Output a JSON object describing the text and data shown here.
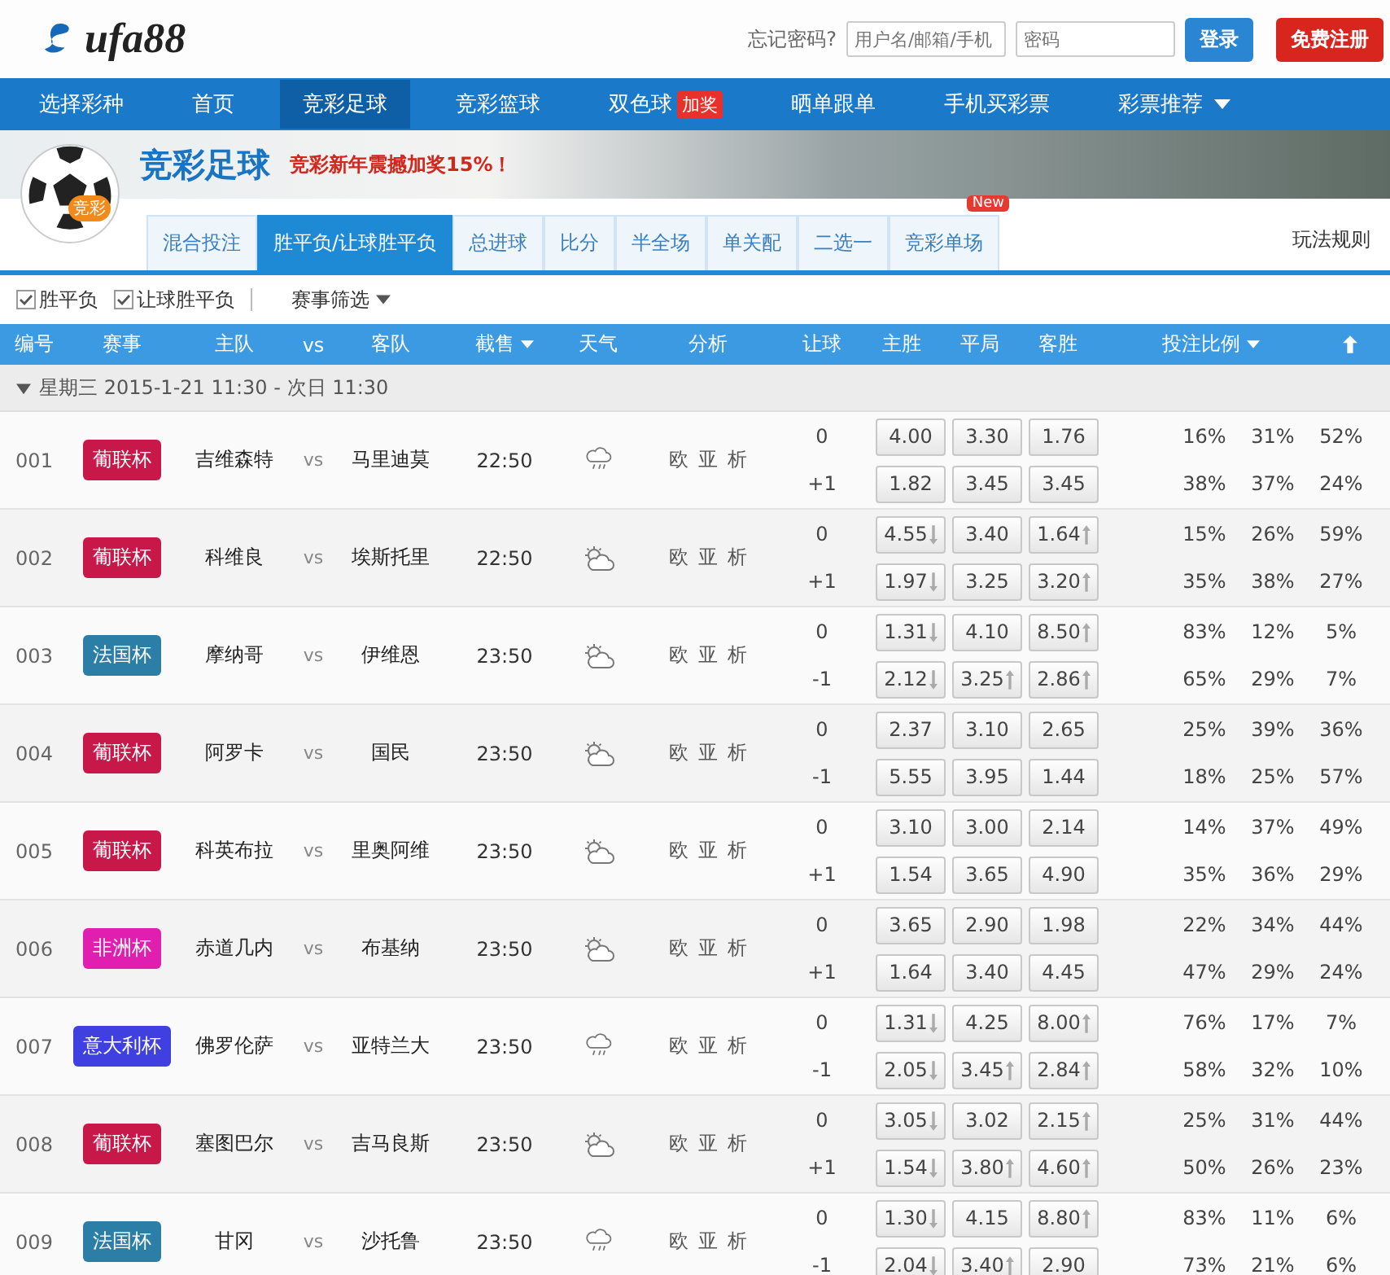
{
  "header": {
    "logo": "ufa88",
    "forgot_password": "忘记密码?",
    "username": {
      "placeholder": "用户名/邮箱/手机"
    },
    "password": {
      "placeholder": "密码"
    },
    "buttons": [
      {
        "label": "登录",
        "kind": "login"
      },
      {
        "label": "免费注册",
        "kind": "register"
      }
    ]
  },
  "nav": {
    "items": [
      {
        "label": "选择彩种",
        "selected": false
      },
      {
        "label": "首页",
        "selected": false
      },
      {
        "label": "竞彩足球",
        "selected": true
      },
      {
        "label": "竞彩篮球",
        "selected": false
      },
      {
        "label": "双色球",
        "selected": false,
        "badge": "加奖"
      },
      {
        "label": "晒单跟单",
        "selected": false
      },
      {
        "label": "手机买彩票",
        "selected": false
      },
      {
        "label": "彩票推荐",
        "selected": false,
        "dropdown": true
      }
    ]
  },
  "banner": {
    "logo_badge": "竞彩",
    "title": "竞彩足球",
    "promo": "竞彩新年震撼加奖15%！"
  },
  "tabs": [
    {
      "label": "混合投注",
      "selected": false
    },
    {
      "label": "胜平负/让球胜平负",
      "selected": true
    },
    {
      "label": "总进球",
      "selected": false
    },
    {
      "label": "比分",
      "selected": false
    },
    {
      "label": "半全场",
      "selected": false
    },
    {
      "label": "单关配",
      "selected": false
    },
    {
      "label": "二选一",
      "selected": false
    },
    {
      "label": "竞彩单场",
      "selected": false,
      "badge": "New"
    }
  ],
  "rules_link": "玩法规则",
  "filters": {
    "checkboxes": [
      {
        "label": "胜平负",
        "checked": true
      },
      {
        "label": "让球胜平负",
        "checked": true
      }
    ],
    "dropdown": "赛事筛选"
  },
  "table": {
    "columns": [
      {
        "label": "编号",
        "sortable": false
      },
      {
        "label": "赛事",
        "sortable": false
      },
      {
        "label": "主队",
        "sortable": false
      },
      {
        "label": "vs",
        "sortable": false
      },
      {
        "label": "客队",
        "sortable": false
      },
      {
        "label": "截售",
        "sortable": true
      },
      {
        "label": "天气",
        "sortable": false
      },
      {
        "label": "分析",
        "sortable": false
      },
      {
        "label": "让球",
        "sortable": false
      },
      {
        "label": "主胜",
        "sortable": false
      },
      {
        "label": "平局",
        "sortable": false
      },
      {
        "label": "客胜",
        "sortable": false
      },
      {
        "label": "投注比例",
        "sortable": true
      }
    ],
    "group": {
      "label": "星期三 2015-1-21 11:30 - 次日 11:30",
      "expanded": true
    },
    "rows": [
      {
        "id": "001",
        "league": "葡联杯",
        "color": "#c8184a",
        "home": "吉维森特",
        "vs": "vs",
        "away": "马里迪莫",
        "time": "22:50",
        "weather": {
          "kind": "rain"
        },
        "analysis": [
          "欧",
          "亚",
          "析"
        ],
        "lines": [
          {
            "handicap": "0",
            "odds": [
              {
                "v": "4.00",
                "kind": "flat"
              },
              {
                "v": "3.30",
                "kind": "flat"
              },
              {
                "v": "1.76",
                "kind": "flat"
              }
            ],
            "ratios": [
              "16%",
              "31%",
              "52%"
            ]
          },
          {
            "handicap": "+1",
            "odds": [
              {
                "v": "1.82",
                "kind": "flat"
              },
              {
                "v": "3.45",
                "kind": "flat"
              },
              {
                "v": "3.45",
                "kind": "flat"
              }
            ],
            "ratios": [
              "38%",
              "37%",
              "24%"
            ]
          }
        ]
      },
      {
        "id": "002",
        "league": "葡联杯",
        "color": "#c8184a",
        "home": "科维良",
        "vs": "vs",
        "away": "埃斯托里",
        "time": "22:50",
        "weather": {
          "kind": "cloudy"
        },
        "analysis": [
          "欧",
          "亚",
          "析"
        ],
        "lines": [
          {
            "handicap": "0",
            "odds": [
              {
                "v": "4.55",
                "kind": "down"
              },
              {
                "v": "3.40",
                "kind": "flat"
              },
              {
                "v": "1.64",
                "kind": "up"
              }
            ],
            "ratios": [
              "15%",
              "26%",
              "59%"
            ]
          },
          {
            "handicap": "+1",
            "odds": [
              {
                "v": "1.97",
                "kind": "down"
              },
              {
                "v": "3.25",
                "kind": "flat"
              },
              {
                "v": "3.20",
                "kind": "up"
              }
            ],
            "ratios": [
              "35%",
              "38%",
              "27%"
            ]
          }
        ]
      },
      {
        "id": "003",
        "league": "法国杯",
        "color": "#2b7fa7",
        "home": "摩纳哥",
        "vs": "vs",
        "away": "伊维恩",
        "time": "23:50",
        "weather": {
          "kind": "cloudy"
        },
        "analysis": [
          "欧",
          "亚",
          "析"
        ],
        "lines": [
          {
            "handicap": "0",
            "odds": [
              {
                "v": "1.31",
                "kind": "down"
              },
              {
                "v": "4.10",
                "kind": "flat"
              },
              {
                "v": "8.50",
                "kind": "up"
              }
            ],
            "ratios": [
              "83%",
              "12%",
              "5%"
            ]
          },
          {
            "handicap": "-1",
            "odds": [
              {
                "v": "2.12",
                "kind": "down"
              },
              {
                "v": "3.25",
                "kind": "up"
              },
              {
                "v": "2.86",
                "kind": "up"
              }
            ],
            "ratios": [
              "65%",
              "29%",
              "7%"
            ]
          }
        ]
      },
      {
        "id": "004",
        "league": "葡联杯",
        "color": "#c8184a",
        "home": "阿罗卡",
        "vs": "vs",
        "away": "国民",
        "time": "23:50",
        "weather": {
          "kind": "cloudy"
        },
        "analysis": [
          "欧",
          "亚",
          "析"
        ],
        "lines": [
          {
            "handicap": "0",
            "odds": [
              {
                "v": "2.37",
                "kind": "flat"
              },
              {
                "v": "3.10",
                "kind": "flat"
              },
              {
                "v": "2.65",
                "kind": "flat"
              }
            ],
            "ratios": [
              "25%",
              "39%",
              "36%"
            ]
          },
          {
            "handicap": "-1",
            "odds": [
              {
                "v": "5.55",
                "kind": "flat"
              },
              {
                "v": "3.95",
                "kind": "flat"
              },
              {
                "v": "1.44",
                "kind": "flat"
              }
            ],
            "ratios": [
              "18%",
              "25%",
              "57%"
            ]
          }
        ]
      },
      {
        "id": "005",
        "league": "葡联杯",
        "color": "#c8184a",
        "home": "科英布拉",
        "vs": "vs",
        "away": "里奥阿维",
        "time": "23:50",
        "weather": {
          "kind": "cloudy"
        },
        "analysis": [
          "欧",
          "亚",
          "析"
        ],
        "lines": [
          {
            "handicap": "0",
            "odds": [
              {
                "v": "3.10",
                "kind": "flat"
              },
              {
                "v": "3.00",
                "kind": "flat"
              },
              {
                "v": "2.14",
                "kind": "flat"
              }
            ],
            "ratios": [
              "14%",
              "37%",
              "49%"
            ]
          },
          {
            "handicap": "+1",
            "odds": [
              {
                "v": "1.54",
                "kind": "flat"
              },
              {
                "v": "3.65",
                "kind": "flat"
              },
              {
                "v": "4.90",
                "kind": "flat"
              }
            ],
            "ratios": [
              "35%",
              "36%",
              "29%"
            ]
          }
        ]
      },
      {
        "id": "006",
        "league": "非洲杯",
        "color": "#e01fb0",
        "home": "赤道几内",
        "vs": "vs",
        "away": "布基纳",
        "time": "23:50",
        "weather": {
          "kind": "cloudy"
        },
        "analysis": [
          "欧",
          "亚",
          "析"
        ],
        "lines": [
          {
            "handicap": "0",
            "odds": [
              {
                "v": "3.65",
                "kind": "flat"
              },
              {
                "v": "2.90",
                "kind": "flat"
              },
              {
                "v": "1.98",
                "kind": "flat"
              }
            ],
            "ratios": [
              "22%",
              "34%",
              "44%"
            ]
          },
          {
            "handicap": "+1",
            "odds": [
              {
                "v": "1.64",
                "kind": "flat"
              },
              {
                "v": "3.40",
                "kind": "flat"
              },
              {
                "v": "4.45",
                "kind": "flat"
              }
            ],
            "ratios": [
              "47%",
              "29%",
              "24%"
            ]
          }
        ]
      },
      {
        "id": "007",
        "league": "意大利杯",
        "color": "#4040e0",
        "home": "佛罗伦萨",
        "vs": "vs",
        "away": "亚特兰大",
        "time": "23:50",
        "weather": {
          "kind": "rain"
        },
        "analysis": [
          "欧",
          "亚",
          "析"
        ],
        "lines": [
          {
            "handicap": "0",
            "odds": [
              {
                "v": "1.31",
                "kind": "down"
              },
              {
                "v": "4.25",
                "kind": "flat"
              },
              {
                "v": "8.00",
                "kind": "up"
              }
            ],
            "ratios": [
              "76%",
              "17%",
              "7%"
            ]
          },
          {
            "handicap": "-1",
            "odds": [
              {
                "v": "2.05",
                "kind": "down"
              },
              {
                "v": "3.45",
                "kind": "up"
              },
              {
                "v": "2.84",
                "kind": "up"
              }
            ],
            "ratios": [
              "58%",
              "32%",
              "10%"
            ]
          }
        ]
      },
      {
        "id": "008",
        "league": "葡联杯",
        "color": "#c8184a",
        "home": "塞图巴尔",
        "vs": "vs",
        "away": "吉马良斯",
        "time": "23:50",
        "weather": {
          "kind": "cloudy"
        },
        "analysis": [
          "欧",
          "亚",
          "析"
        ],
        "lines": [
          {
            "handicap": "0",
            "odds": [
              {
                "v": "3.05",
                "kind": "down"
              },
              {
                "v": "3.02",
                "kind": "flat"
              },
              {
                "v": "2.15",
                "kind": "up"
              }
            ],
            "ratios": [
              "25%",
              "31%",
              "44%"
            ]
          },
          {
            "handicap": "+1",
            "odds": [
              {
                "v": "1.54",
                "kind": "down"
              },
              {
                "v": "3.80",
                "kind": "up"
              },
              {
                "v": "4.60",
                "kind": "up"
              }
            ],
            "ratios": [
              "50%",
              "26%",
              "23%"
            ]
          }
        ]
      },
      {
        "id": "009",
        "league": "法国杯",
        "color": "#2b7fa7",
        "home": "甘冈",
        "vs": "vs",
        "away": "沙托鲁",
        "time": "23:50",
        "weather": {
          "kind": "rain"
        },
        "analysis": [
          "欧",
          "亚",
          "析"
        ],
        "lines": [
          {
            "handicap": "0",
            "odds": [
              {
                "v": "1.30",
                "kind": "down"
              },
              {
                "v": "4.15",
                "kind": "flat"
              },
              {
                "v": "8.80",
                "kind": "up"
              }
            ],
            "ratios": [
              "83%",
              "11%",
              "6%"
            ]
          },
          {
            "handicap": "-1",
            "odds": [
              {
                "v": "2.04",
                "kind": "down"
              },
              {
                "v": "3.40",
                "kind": "up"
              },
              {
                "v": "2.90",
                "kind": "flat"
              }
            ],
            "ratios": [
              "73%",
              "21%",
              "6%"
            ]
          }
        ]
      }
    ]
  }
}
